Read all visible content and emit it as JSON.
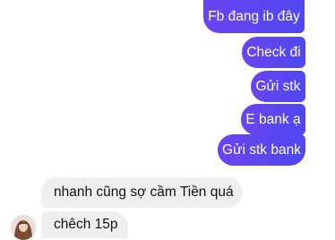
{
  "conversation": {
    "sent_messages": [
      {
        "text": "Fb đang ib đây"
      },
      {
        "text": "Check đi"
      },
      {
        "text": "Gửi stk"
      },
      {
        "text": "E bank ạ"
      },
      {
        "text": "Gửi stk bank"
      }
    ],
    "received_messages": [
      {
        "text": "nhanh cũng sợ cầm Tiền quá"
      },
      {
        "text": "chêch 15p"
      }
    ],
    "colors": {
      "sent_bubble": "#5b45f0",
      "received_bubble": "#efefef",
      "sent_text": "#ffffff",
      "received_text": "#111111"
    },
    "sender_avatar_icon": "profile-photo"
  }
}
